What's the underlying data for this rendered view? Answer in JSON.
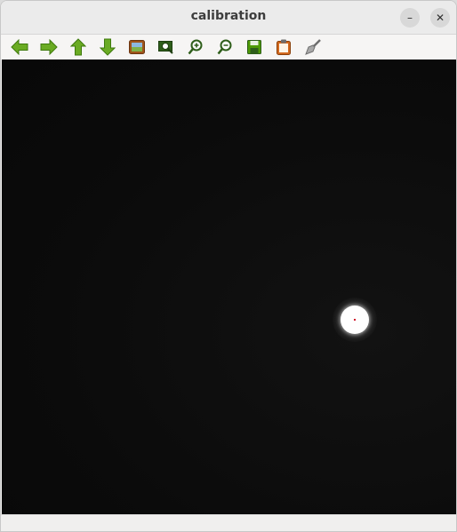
{
  "window": {
    "title": "calibration",
    "minimize_glyph": "–",
    "close_glyph": "✕"
  },
  "toolbar": {
    "tools": [
      {
        "name": "back-arrow-icon",
        "color": "#4e9a06"
      },
      {
        "name": "forward-arrow-icon",
        "color": "#4e9a06"
      },
      {
        "name": "up-arrow-icon",
        "color": "#4e9a06"
      },
      {
        "name": "down-arrow-icon",
        "color": "#4e9a06"
      },
      {
        "name": "image-icon",
        "color": "#8f5902"
      },
      {
        "name": "zoom-fit-icon",
        "color": "#4e9a06"
      },
      {
        "name": "zoom-in-icon",
        "color": "#4e9a06"
      },
      {
        "name": "zoom-out-icon",
        "color": "#4e9a06"
      },
      {
        "name": "save-icon",
        "color": "#4e9a06"
      },
      {
        "name": "clipboard-icon",
        "color": "#ce5c00"
      },
      {
        "name": "clear-brush-icon",
        "color": "#888a85"
      }
    ]
  },
  "canvas": {
    "background_color": "#0b0b0b",
    "spot_color": "#ffffff",
    "centroid_color": "#d0102a"
  },
  "statusbar": {
    "text": ""
  }
}
